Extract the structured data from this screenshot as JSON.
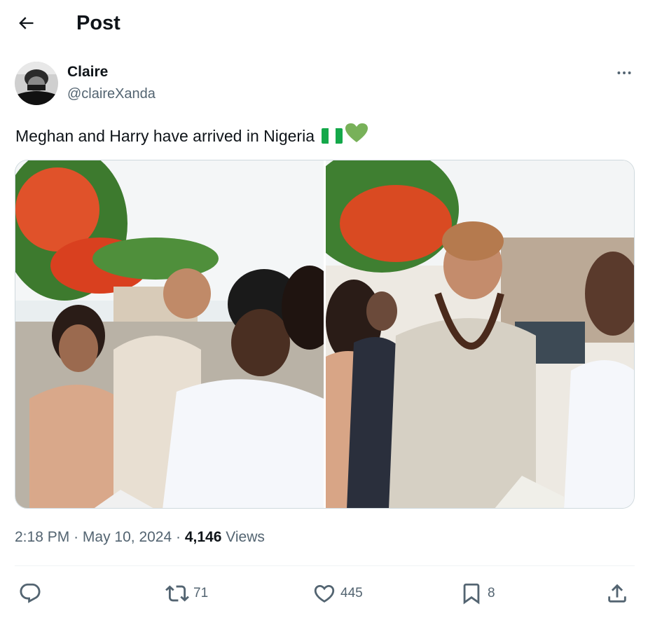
{
  "header": {
    "title": "Post"
  },
  "author": {
    "name": "Claire",
    "handle": "@claireXanda"
  },
  "tweet": {
    "text": "Meghan and Harry have arrived in Nigeria",
    "emoji": "💚"
  },
  "meta": {
    "time": "2:18 PM",
    "separator": "·",
    "date": "May 10, 2024",
    "views_count": "4,146",
    "views_label": "Views"
  },
  "actions": {
    "retweets": "71",
    "likes": "445",
    "bookmarks": "8"
  },
  "icons": [
    "back-arrow-icon",
    "more-icon",
    "reply-icon",
    "retweet-icon",
    "like-icon",
    "bookmark-icon",
    "share-icon"
  ],
  "colors": {
    "text": "#0f1419",
    "secondary": "#536471",
    "border": "#cfd9de",
    "green": "#14a84a"
  }
}
